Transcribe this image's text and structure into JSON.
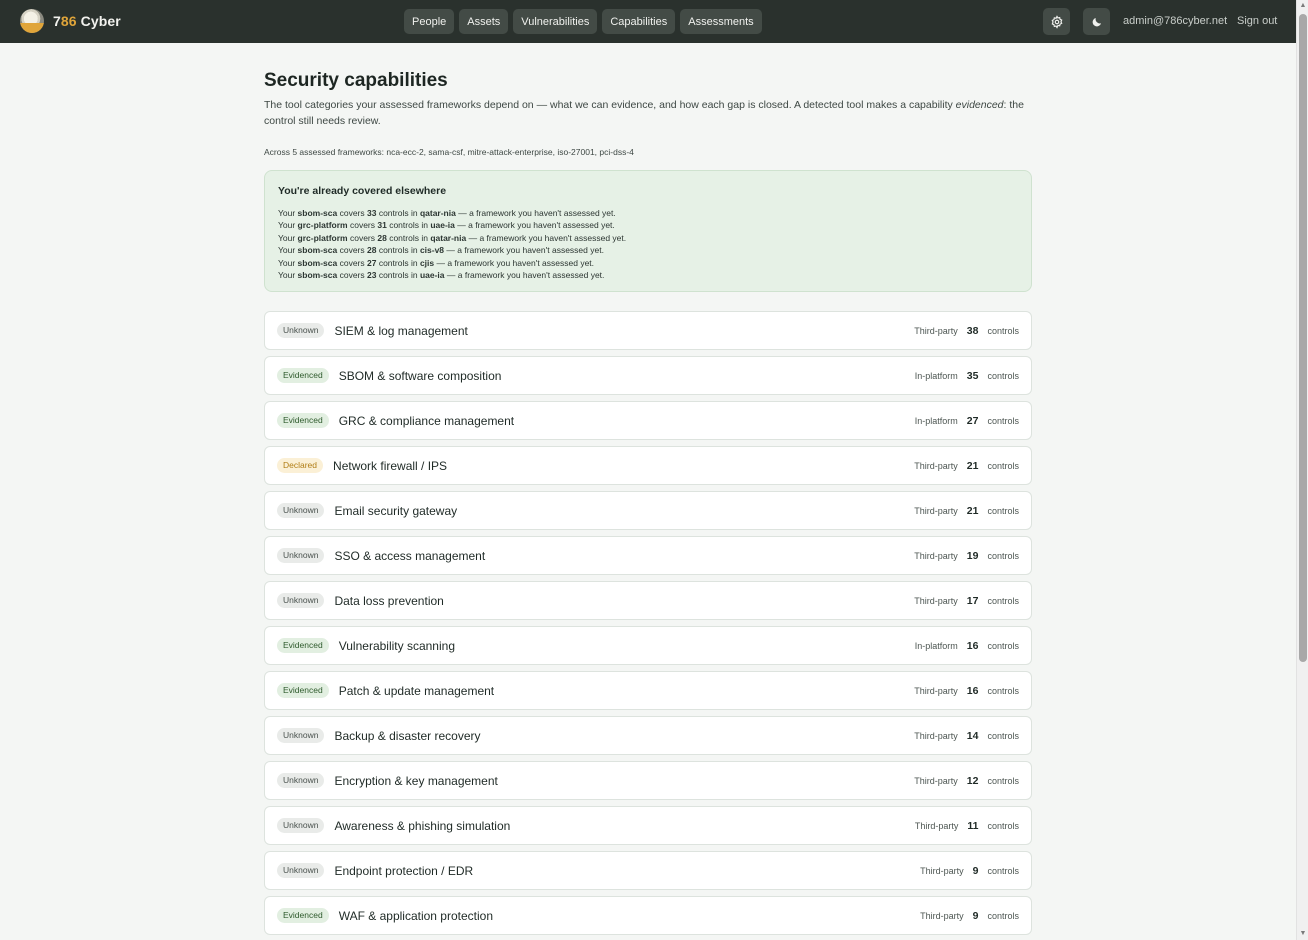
{
  "brand": {
    "name_prefix": "7",
    "name_accent": "86",
    "name_suffix": " Cyber"
  },
  "nav": {
    "items": [
      {
        "label": "People"
      },
      {
        "label": "Assets"
      },
      {
        "label": "Vulnerabilities"
      },
      {
        "label": "Capabilities"
      },
      {
        "label": "Assessments"
      }
    ]
  },
  "header": {
    "settings_icon": "gear-icon",
    "theme_icon": "moon-icon",
    "user_email": "admin@786cyber.net",
    "sign_out_label": "Sign out"
  },
  "page": {
    "title": "Security capabilities",
    "subtitle_main": "The tool categories your assessed frameworks depend on — what we can evidence, and how each gap is closed. A detected tool makes a capability ",
    "subtitle_em": "evidenced",
    "subtitle_tail": ": the control still needs review.",
    "frameworks_line": "Across 5 assessed frameworks: nca-ecc-2, sama-csf, mitre-attack-enterprise, iso-27001, pci-dss-4"
  },
  "covered": {
    "title": "You're already covered elsewhere",
    "lines": [
      {
        "prefix": "Your ",
        "tool": "sbom-sca",
        "mid": " covers ",
        "count": "33",
        "mid2": " controls in ",
        "framework": "qatar-nia",
        "suffix": " — a framework you haven't assessed yet."
      },
      {
        "prefix": "Your ",
        "tool": "grc-platform",
        "mid": " covers ",
        "count": "31",
        "mid2": " controls in ",
        "framework": "uae-ia",
        "suffix": " — a framework you haven't assessed yet."
      },
      {
        "prefix": "Your ",
        "tool": "grc-platform",
        "mid": " covers ",
        "count": "28",
        "mid2": " controls in ",
        "framework": "qatar-nia",
        "suffix": " — a framework you haven't assessed yet."
      },
      {
        "prefix": "Your ",
        "tool": "sbom-sca",
        "mid": " covers ",
        "count": "28",
        "mid2": " controls in ",
        "framework": "cis-v8",
        "suffix": " — a framework you haven't assessed yet."
      },
      {
        "prefix": "Your ",
        "tool": "sbom-sca",
        "mid": " covers ",
        "count": "27",
        "mid2": " controls in ",
        "framework": "cjis",
        "suffix": " — a framework you haven't assessed yet."
      },
      {
        "prefix": "Your ",
        "tool": "sbom-sca",
        "mid": " covers ",
        "count": "23",
        "mid2": " controls in ",
        "framework": "uae-ia",
        "suffix": " — a framework you haven't assessed yet."
      }
    ]
  },
  "capabilities": [
    {
      "status": "Unknown",
      "status_key": "unknown",
      "name": "SIEM & log management",
      "source": "Third-party",
      "count": "38",
      "unit": "controls"
    },
    {
      "status": "Evidenced",
      "status_key": "evidenced",
      "name": "SBOM & software composition",
      "source": "In-platform",
      "count": "35",
      "unit": "controls"
    },
    {
      "status": "Evidenced",
      "status_key": "evidenced",
      "name": "GRC & compliance management",
      "source": "In-platform",
      "count": "27",
      "unit": "controls"
    },
    {
      "status": "Declared",
      "status_key": "declared",
      "name": "Network firewall / IPS",
      "source": "Third-party",
      "count": "21",
      "unit": "controls"
    },
    {
      "status": "Unknown",
      "status_key": "unknown",
      "name": "Email security gateway",
      "source": "Third-party",
      "count": "21",
      "unit": "controls"
    },
    {
      "status": "Unknown",
      "status_key": "unknown",
      "name": "SSO & access management",
      "source": "Third-party",
      "count": "19",
      "unit": "controls"
    },
    {
      "status": "Unknown",
      "status_key": "unknown",
      "name": "Data loss prevention",
      "source": "Third-party",
      "count": "17",
      "unit": "controls"
    },
    {
      "status": "Evidenced",
      "status_key": "evidenced",
      "name": "Vulnerability scanning",
      "source": "In-platform",
      "count": "16",
      "unit": "controls"
    },
    {
      "status": "Evidenced",
      "status_key": "evidenced",
      "name": "Patch & update management",
      "source": "Third-party",
      "count": "16",
      "unit": "controls"
    },
    {
      "status": "Unknown",
      "status_key": "unknown",
      "name": "Backup & disaster recovery",
      "source": "Third-party",
      "count": "14",
      "unit": "controls"
    },
    {
      "status": "Unknown",
      "status_key": "unknown",
      "name": "Encryption & key management",
      "source": "Third-party",
      "count": "12",
      "unit": "controls"
    },
    {
      "status": "Unknown",
      "status_key": "unknown",
      "name": "Awareness & phishing simulation",
      "source": "Third-party",
      "count": "11",
      "unit": "controls"
    },
    {
      "status": "Unknown",
      "status_key": "unknown",
      "name": "Endpoint protection / EDR",
      "source": "Third-party",
      "count": "9",
      "unit": "controls"
    },
    {
      "status": "Evidenced",
      "status_key": "evidenced",
      "name": "WAF & application protection",
      "source": "Third-party",
      "count": "9",
      "unit": "controls"
    }
  ]
}
